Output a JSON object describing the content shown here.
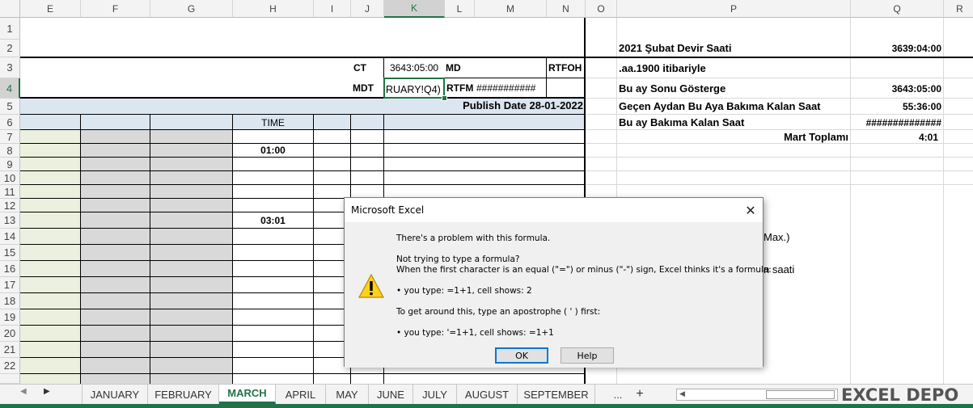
{
  "columns": [
    "E",
    "F",
    "G",
    "H",
    "I",
    "J",
    "K",
    "L",
    "M",
    "N",
    "O",
    "P",
    "Q",
    "R"
  ],
  "rows": [
    "1",
    "2",
    "3",
    "4",
    "5",
    "6",
    "7",
    "8",
    "9",
    "10",
    "11",
    "12",
    "13",
    "14",
    "15",
    "16",
    "17",
    "18",
    "19",
    "20",
    "21",
    "22"
  ],
  "left_sheet": {
    "ct_label": "CT",
    "ct_value": "3643:05:00",
    "md_label": "MD",
    "rtfoh_label": "RTFOH",
    "mdt_label": "MDT",
    "k4_value": "RUARY!Q4)",
    "rtfm_label": "RTFM",
    "rtfm_value": "###########",
    "publish_date": "Publish Date 28-01-2022",
    "time_header": "TIME",
    "h8_value": "01:00",
    "h13_value": "03:01"
  },
  "right_sheet": {
    "rows": [
      {
        "label": "2021 Şubat Devir Saati",
        "value": "3639:04:00"
      },
      {
        "label": ".aa.1900 itibariyle",
        "value": ""
      },
      {
        "label": "Bu ay Sonu Gösterge",
        "value": "3643:05:00"
      },
      {
        "label": "Geçen Aydan Bu Aya Bakıma Kalan Saat",
        "value": "55:36:00"
      },
      {
        "label": "Bu ay Bakıma Kalan Saat",
        "value": "##############"
      },
      {
        "label": "Mart Toplamı",
        "value": "4:01"
      }
    ],
    "partial_text_1": "Max.)",
    "partial_text_2": "n saati"
  },
  "dialog": {
    "title": "Microsoft Excel",
    "line1": "There's a problem with this formula.",
    "line2": "Not trying to type a formula?",
    "line3": "When the first character is an equal (\"=\") or minus (\"-\") sign, Excel thinks it's a formula:",
    "line4": "• you type:   =1+1, cell shows:   2",
    "line5": "To get around this, type an apostrophe ( ' ) first:",
    "line6": "• you type:   '=1+1, cell shows:   =1+1",
    "ok_label": "OK",
    "help_label": "Help"
  },
  "tabs": [
    "JANUARY",
    "FEBRUARY",
    "MARCH",
    "APRIL",
    "MAY",
    "JUNE",
    "JULY",
    "AUGUST",
    "SEPTEMBER"
  ],
  "active_tab": "MARCH",
  "more_tabs": "...",
  "add_sheet": "+",
  "logo_text": "EXCEL DEPO",
  "colors": {
    "excel_green": "#217346",
    "header_blue": "#dce6f1",
    "light_green": "#ebf1de",
    "grey_fill": "#d9d9d9"
  }
}
